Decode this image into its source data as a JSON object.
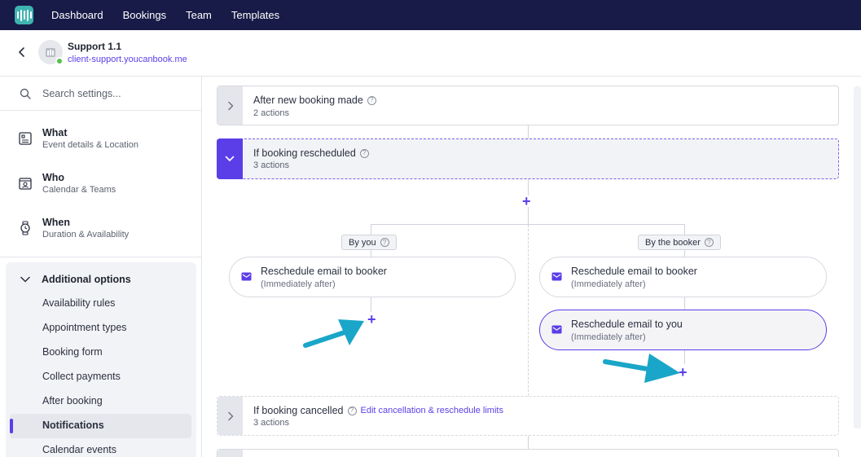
{
  "nav": {
    "items": [
      "Dashboard",
      "Bookings",
      "Team",
      "Templates"
    ]
  },
  "header": {
    "title": "Support 1.1",
    "link": "client-support.youcanbook.me"
  },
  "sidebar": {
    "search_placeholder": "Search settings...",
    "sections": [
      {
        "title": "What",
        "subtitle": "Event details & Location",
        "icon": "document-icon"
      },
      {
        "title": "Who",
        "subtitle": "Calendar & Teams",
        "icon": "contact-card-icon"
      },
      {
        "title": "When",
        "subtitle": "Duration & Availability",
        "icon": "watch-icon"
      }
    ],
    "additional": {
      "heading": "Additional options",
      "options": [
        "Availability rules",
        "Appointment types",
        "Booking form",
        "Collect payments",
        "After booking",
        "Notifications",
        "Calendar events"
      ],
      "active": "Notifications"
    }
  },
  "workflow": {
    "trigger_new": {
      "title": "After new booking made",
      "count": "2 actions"
    },
    "trigger_rescheduled": {
      "title": "If booking rescheduled",
      "count": "3 actions"
    },
    "branch_left": {
      "label": "By you",
      "actions": [
        {
          "title": "Reschedule email to booker",
          "timing": "(Immediately after)"
        }
      ]
    },
    "branch_right": {
      "label": "By the booker",
      "actions": [
        {
          "title": "Reschedule email to booker",
          "timing": "(Immediately after)"
        },
        {
          "title": "Reschedule email to you",
          "timing": "(Immediately after)"
        }
      ]
    },
    "trigger_cancelled": {
      "title": "If booking cancelled",
      "link": "Edit cancellation & reschedule limits",
      "count": "3 actions"
    }
  },
  "colors": {
    "nav_bg": "#181a47",
    "accent": "#5b3ee8",
    "annotation_arrow": "#1aa6c8",
    "logo": "#3fb3b0",
    "online_dot": "#55c04b"
  }
}
